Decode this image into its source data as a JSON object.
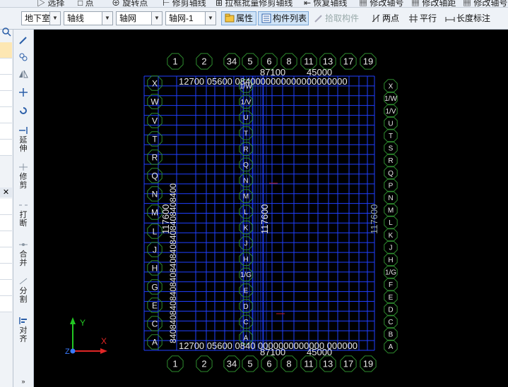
{
  "top_strip": {
    "items": [
      "选择",
      "点",
      "旋转点",
      "修剪轴线",
      "拉框批量修剪轴线",
      "恢复轴线",
      "修改轴号",
      "修改轴距",
      "修改轴号"
    ]
  },
  "toolbar": {
    "floor_value": "地下室",
    "category_value": "轴线",
    "type_value": "轴网",
    "instance_value": "轴网-1",
    "properties_label": "属性",
    "component_list_label": "构件列表",
    "pick_component_label": "拾取构件",
    "two_points_label": "两点",
    "parallel_label": "平行",
    "length_dim_label": "长度标注"
  },
  "side_tools": {
    "extend": "延伸",
    "trim": "修剪",
    "break": "打断",
    "merge": "合并",
    "split": "分割",
    "align": "对齐"
  },
  "colors": {
    "grid_line": "#1f3fff",
    "axis_bubble": "#2e8b2e",
    "label": "#e8e8e8",
    "background": "#000000"
  },
  "axis": {
    "col_labels": [
      "1",
      "2",
      "34",
      "5",
      "6",
      "8",
      "11",
      "13",
      "17",
      "19"
    ],
    "row_labels": [
      "X",
      "W",
      "V",
      "T",
      "R",
      "Q",
      "N",
      "M",
      "L",
      "J",
      "H",
      "G",
      "E",
      "C",
      "A"
    ],
    "right_row_labels": [
      "X",
      "1/W",
      "1/V",
      "U",
      "T",
      "S",
      "R",
      "Q",
      "P",
      "N",
      "M",
      "L",
      "K",
      "J",
      "H",
      "1/G",
      "F",
      "E",
      "D",
      "C",
      "B",
      "A"
    ],
    "top_dim_text": "12700 05600 0840000000000000000000",
    "top_total_a": "87100",
    "top_total_b": "45000",
    "bottom_dim_text": "12700 05600 0840 0000000000000 000000",
    "bottom_total_a": "87100",
    "bottom_total_b": "45000",
    "left_dim_text": "8408408408408408408408408408408400",
    "left_total": "117600",
    "right_total": "117600",
    "inner_col_labels": [
      "1/W",
      "1/V",
      "U",
      "T",
      "R",
      "Q",
      "N",
      "M",
      "L",
      "K",
      "J",
      "H",
      "1/G",
      "E",
      "D",
      "C",
      "A"
    ]
  },
  "coord": {
    "y_label": "Y",
    "x_label": "X",
    "z_label": "Z"
  }
}
